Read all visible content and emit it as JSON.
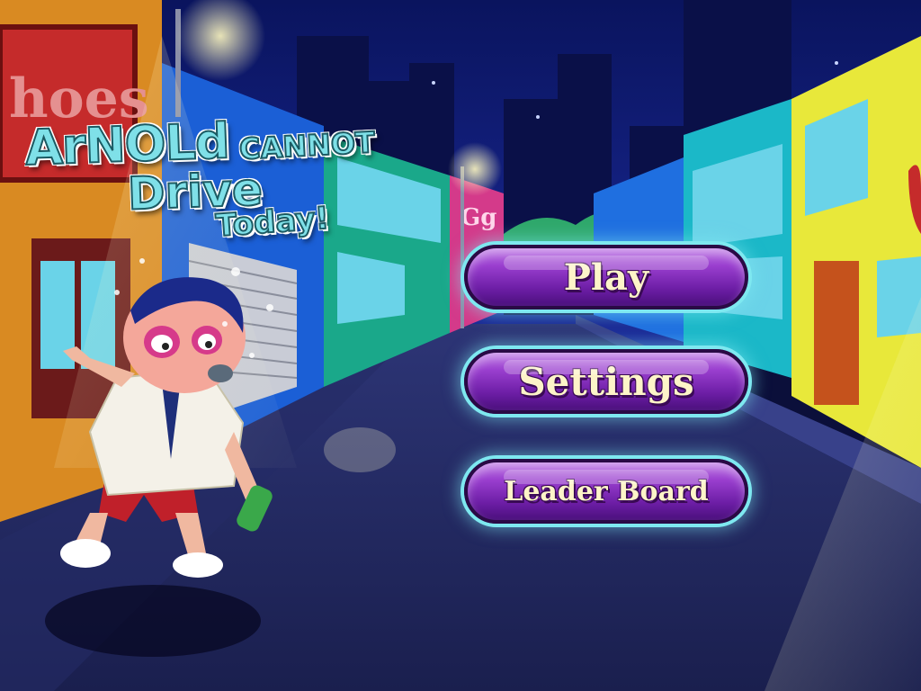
{
  "game": {
    "title_line1": "ArNOLd",
    "title_line2": "CANNOT",
    "title_line3": "Drive",
    "title_line4": "Today!"
  },
  "menu": {
    "play_label": "Play",
    "settings_label": "Settings",
    "leaderboard_label": "Leader Board"
  },
  "scene": {
    "shop_sign_left": "hoes",
    "shop_sign_mid": "Gg"
  },
  "colors": {
    "night_sky": "#0d1a6e",
    "button_purple": "#8a2ec4",
    "button_glow": "#7ee8f0",
    "label_cream": "#fdf4c8"
  }
}
